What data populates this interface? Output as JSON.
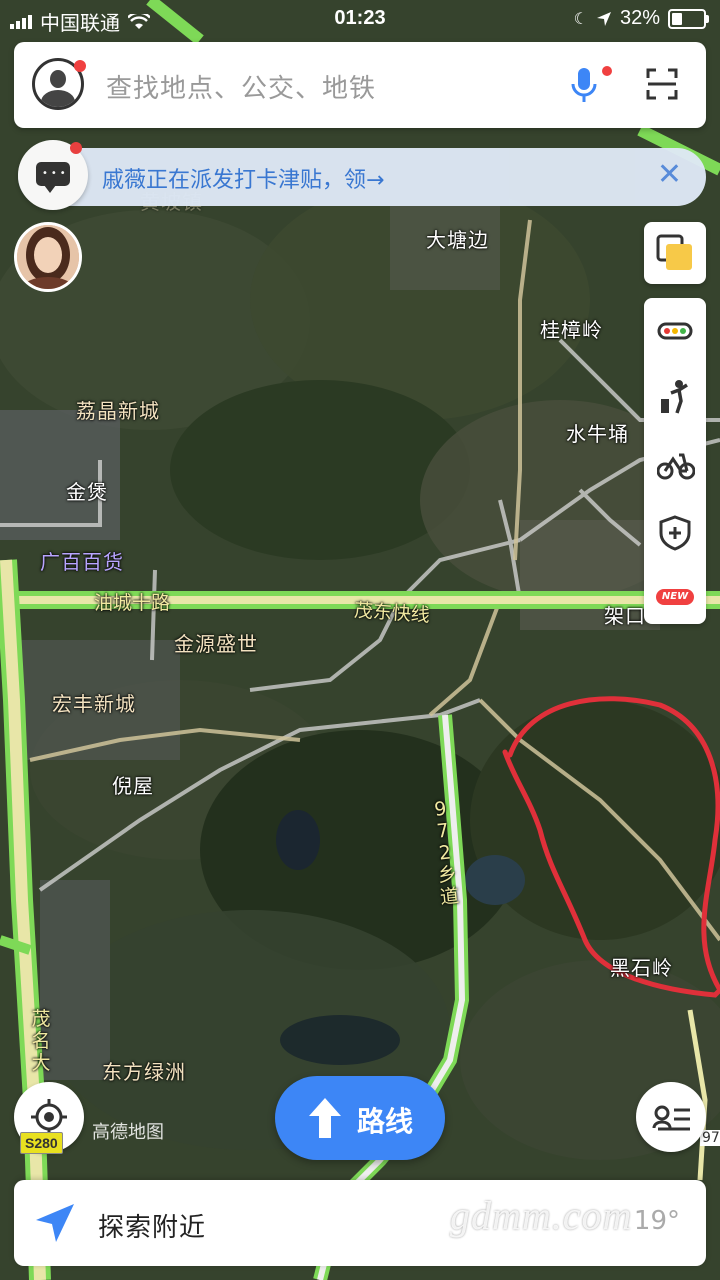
{
  "status_bar": {
    "carrier": "中国联通",
    "time": "01:23",
    "battery_pct": "32%"
  },
  "search": {
    "placeholder": "查找地点、公交、地铁"
  },
  "promo": {
    "text": "戚薇正在派发打卡津贴，领→"
  },
  "places": {
    "datangbian": "大塘边",
    "guizhangling": "桂樟岭",
    "lijingxincheng": "荔晶新城",
    "shuiniuyong": "水牛埇",
    "jinbao": "金煲",
    "guangbai": "广百百货",
    "youchengshilu": "油城十路",
    "maodongkuaixian": "茂东快线",
    "jiakou": "架口",
    "jinyuanshengshi": "金源盛世",
    "hongfengxincheng": "宏丰新城",
    "niwu": "倪屋",
    "road_972": "972乡道",
    "heishiling": "黑石岭",
    "maoming_da": "茂名大",
    "dongfanglvzhou": "东方绿洲",
    "huangpo_faded": "黄坡镇"
  },
  "tools": {
    "new_badge": "NEW"
  },
  "route_button": {
    "label": "路线"
  },
  "map_logo": "高德地图",
  "road_shield": "S280",
  "edge_shield": "97",
  "explore": {
    "label": "探索附近",
    "weather": "19°"
  },
  "watermark": "gdmm.com",
  "colors": {
    "highway_green": "#7ed957",
    "highway_fill": "#e8e6a8",
    "accent_blue": "#3d86f6",
    "alert_red": "#f04040",
    "annotation_red": "#e0303a"
  },
  "icons": [
    "signal-icon",
    "wifi-icon",
    "location-arrow-icon",
    "battery-icon",
    "user-icon",
    "microphone-icon",
    "scan-icon",
    "message-icon",
    "close-icon",
    "layers-icon",
    "traffic-icon",
    "walking-icon",
    "bike-icon",
    "shield-plus-icon",
    "locate-icon",
    "route-arrow-icon",
    "list-icon",
    "navigation-arrow-icon"
  ]
}
